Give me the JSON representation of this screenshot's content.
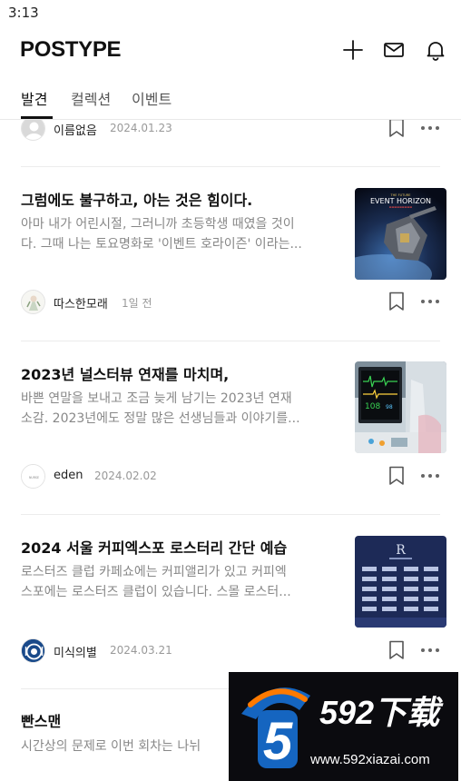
{
  "status": {
    "time": "3:13"
  },
  "header": {
    "logo": "POSTYPE"
  },
  "tabs": [
    {
      "label": "발견",
      "active": true
    },
    {
      "label": "컬렉션",
      "active": false
    },
    {
      "label": "이벤트",
      "active": false
    }
  ],
  "partial_top": {
    "author": "이름없음",
    "date": "2024.01.23"
  },
  "posts": [
    {
      "title": "그럼에도 불구하고, 아는 것은 힘이다.",
      "excerpt_line1": "아마 내가 어린시절, 그러니까 초등학생 때였을 것이",
      "excerpt_line2": "다. 그때 나는 토요명화로 '이벤트 호라이즌' 이라는...",
      "author": "따스한모래",
      "date": "1일 전",
      "thumb_text": "EVENT HORIZON"
    },
    {
      "title": "2023년 널스터뷰 연재를 마치며,",
      "excerpt_line1": "바쁜 연말을 보내고 조금 늦게 남기는 2023년 연재",
      "excerpt_line2": "소감. 2023년에도 정말 많은 선생님들과 이야기를...",
      "author": "eden",
      "date": "2024.02.02",
      "avatar_text": "NURSE"
    },
    {
      "title": "2024 서울 커피엑스포 로스터리 간단 예습",
      "excerpt_line1": "로스터즈 클럽 카페쇼에는 커피앨리가 있고 커피엑",
      "excerpt_line2": "스포에는 로스터즈 클럽이 있습니다. 스몰 로스터...",
      "author": "미식의별",
      "date": "2024.03.21",
      "thumb_text": "R"
    },
    {
      "title": "빤스맨",
      "excerpt_line1": "시간상의 문제로 이번 회차는 나뉘"
    }
  ],
  "ad": {
    "brand": "592下载",
    "url": "www.592xiazai.com"
  },
  "colors": {
    "ad_blue": "#1565c0",
    "ad_orange": "#ff7a00"
  }
}
